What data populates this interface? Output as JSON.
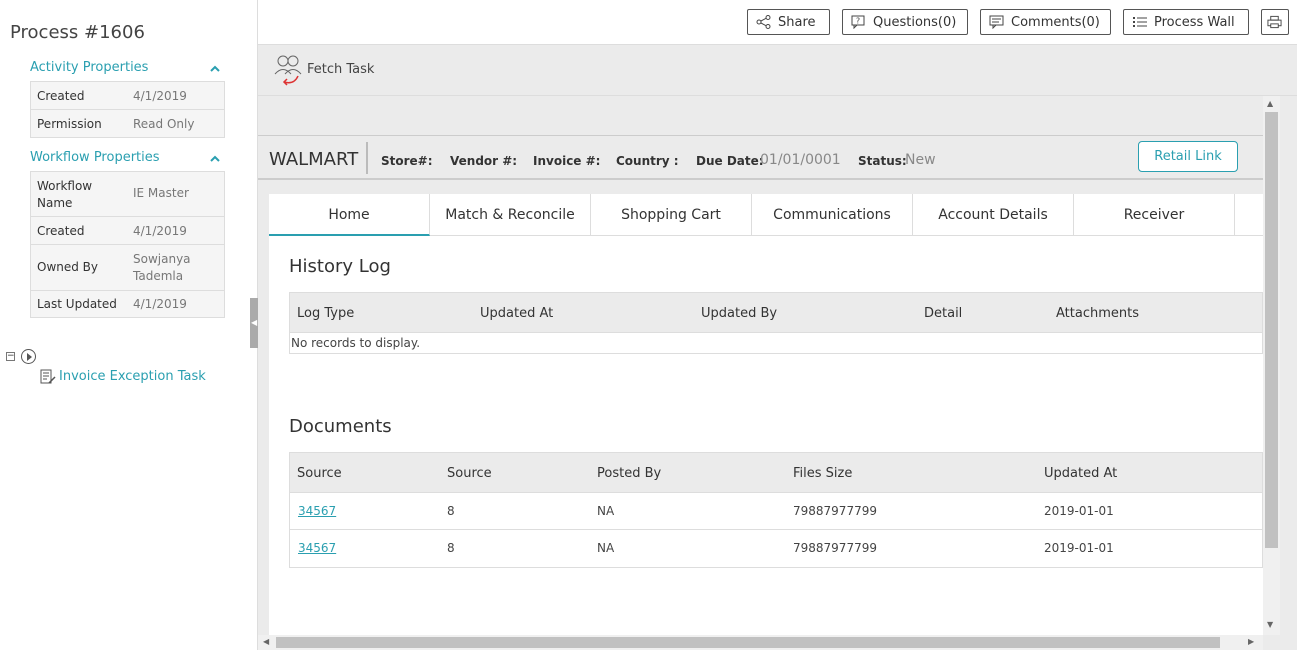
{
  "process": {
    "title": "Process #1606"
  },
  "activity_properties": {
    "header": "Activity Properties",
    "rows": [
      {
        "key": "Created",
        "value": "4/1/2019"
      },
      {
        "key": "Permission",
        "value": "Read Only"
      }
    ]
  },
  "workflow_properties": {
    "header": "Workflow Properties",
    "rows": [
      {
        "key": "Workflow Name",
        "value": "IE Master"
      },
      {
        "key": "Created",
        "value": "4/1/2019"
      },
      {
        "key": "Owned By",
        "value": "Sowjanya Tademla"
      },
      {
        "key": "Last Updated",
        "value": "4/1/2019"
      }
    ]
  },
  "tree": {
    "task_label": "Invoice Exception Task",
    "collapse_symbol": "−"
  },
  "toolbar": {
    "share": "Share",
    "questions": "Questions(0)",
    "comments": "Comments(0)",
    "process_wall": "Process Wall"
  },
  "fetch_task": {
    "label": "Fetch Task"
  },
  "invoice_header": {
    "vendor_name": "WALMART",
    "store_label": "Store#:",
    "vendor_label": "Vendor #:",
    "invoice_label": "Invoice #:",
    "country_label": "Country :",
    "due_date_label": "Due Date:",
    "due_date_value": "01/01/0001",
    "status_label": "Status:",
    "status_value": "New",
    "retail_link": "Retail Link"
  },
  "tabs": [
    "Home",
    "Match & Reconcile",
    "Shopping Cart",
    "Communications",
    "Account Details",
    "Receiver"
  ],
  "history_log": {
    "title": "History Log",
    "columns": [
      "Log Type",
      "Updated At",
      "Updated By",
      "Detail",
      "Attachments"
    ],
    "empty_text": "No records to display."
  },
  "documents": {
    "title": "Documents",
    "columns": [
      "Source",
      "Source",
      "Posted By",
      "Files Size",
      "Updated At"
    ],
    "rows": [
      [
        "34567",
        "8",
        "NA",
        "79887977799",
        "2019-01-01"
      ],
      [
        "34567",
        "8",
        "NA",
        "79887977799",
        "2019-01-01"
      ]
    ]
  },
  "colors": {
    "accent": "#2a9fb0",
    "header_bg": "#ebebeb"
  },
  "icons": {
    "share": "share-icon",
    "questions": "question-icon",
    "comments": "comment-icon",
    "process_wall": "list-icon",
    "print": "print-icon",
    "fetch": "fetch-task-icon"
  }
}
